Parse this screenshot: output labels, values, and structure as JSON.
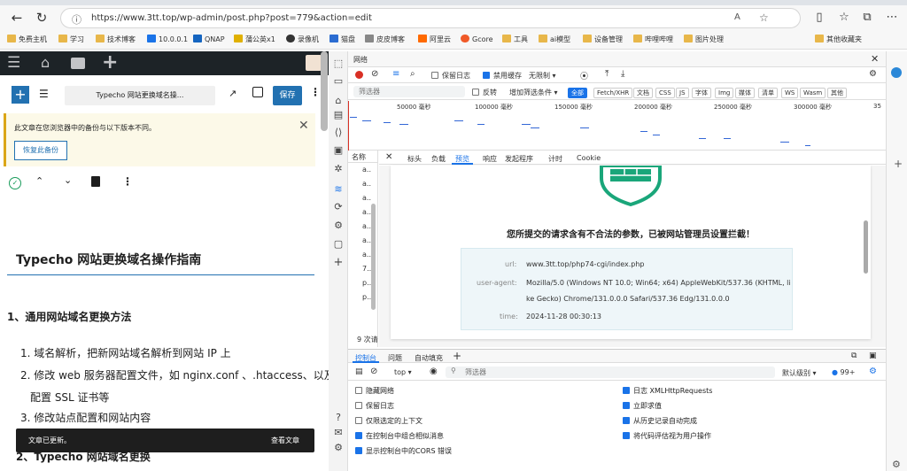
{
  "browser": {
    "url": "https://www.3tt.top/wp-admin/post.php?post=779&action=edit",
    "bookmarks": [
      "免费主机",
      "学习",
      "技术博客",
      "10.0.0.1",
      "QNAP",
      "蒲公英x1",
      "录像机",
      "猫盘",
      "皮皮博客",
      "阿里云",
      "Gcore",
      "工具",
      "ai模型",
      "设备管理",
      "哔哩哔哩",
      "图片处理"
    ],
    "other_bookmarks": "其他收藏夹"
  },
  "wp": {
    "post_title_short": "Typecho 网站更换域名操...",
    "save_label": "保存",
    "notice_text": "此文章在您浏览器中的备份与以下版本不同。",
    "restore_label": "恢复此备份",
    "heading": "Typecho 网站更换域名操作指南",
    "section1": "1、通用网站域名更换方法",
    "items": [
      "1. 域名解析，把新网站域名解析到网站 IP 上",
      "2. 修改 web 服务器配置文件，如 nginx.conf 、.htaccess、以及",
      "配置 SSL 证书等",
      "3. 修改站点配置和网站内容"
    ],
    "section2": "2、Typecho 网站域名更换",
    "snackbar_text": "文章已更新。",
    "snackbar_action": "查看文章"
  },
  "devtools": {
    "panel_title": "网络",
    "preserve_log": "保留日志",
    "disable_cache": "禁用缓存",
    "throttle": "无限制",
    "filter_placeholder": "筛选器",
    "invert": "反转",
    "more_filters": "增加筛选条件",
    "filter_chips": [
      "全部",
      "Fetch/XHR",
      "文档",
      "CSS",
      "JS",
      "字体",
      "Img",
      "媒体",
      "清单",
      "WS",
      "Wasm",
      "其他"
    ],
    "timeline_ticks": [
      "50000 毫秒",
      "100000 毫秒",
      "150000 毫秒",
      "200000 毫秒",
      "250000 毫秒",
      "300000 毫秒",
      "35"
    ],
    "name_col": "名称",
    "name_rows": [
      "a..",
      "a..",
      "a..",
      "a..",
      "a..",
      "a..",
      "a..",
      "7..",
      "p..",
      "p.."
    ],
    "request_count": "9 次请",
    "detail_tabs": [
      "标头",
      "负载",
      "预览",
      "响应",
      "发起程序",
      "计时",
      "Cookie"
    ],
    "active_detail_tab": "预览",
    "block_message": "您所提交的请求含有不合法的参数，已被网站管理员设置拦截！",
    "info": [
      {
        "label": "url:",
        "value": "www.3tt.top/php74-cgi/index.php"
      },
      {
        "label": "user-agent:",
        "value": "Mozilla/5.0 (Windows NT 10.0; Win64; x64) AppleWebKit/537.36 (KHTML, li"
      },
      {
        "label": "",
        "value": "ke Gecko) Chrome/131.0.0.0 Safari/537.36 Edg/131.0.0.0"
      },
      {
        "label": "time:",
        "value": "2024-11-28 00:30:13"
      }
    ],
    "drawer_tabs": [
      "控制台",
      "问题",
      "自动填充"
    ],
    "context": "top",
    "console_filter": "筛选器",
    "log_level": "默认级别",
    "issues_count": "99+",
    "options_left": [
      {
        "label": "隐藏网络",
        "checked": false
      },
      {
        "label": "保留日志",
        "checked": false
      },
      {
        "label": "仅限选定的上下文",
        "checked": false
      },
      {
        "label": "在控制台中组合相似消息",
        "checked": true
      },
      {
        "label": "显示控制台中的CORS 错误",
        "checked": true
      }
    ],
    "options_right": [
      {
        "label": "日志 XMLHttpRequests",
        "checked": true
      },
      {
        "label": "立即求值",
        "checked": true
      },
      {
        "label": "从历史记录自动完成",
        "checked": true
      },
      {
        "label": "将代码评估视为用户操作",
        "checked": true
      }
    ]
  },
  "colors": {
    "accent": "#2271b1",
    "shield": "#1aa67a",
    "devtools_blue": "#1a73e8"
  }
}
